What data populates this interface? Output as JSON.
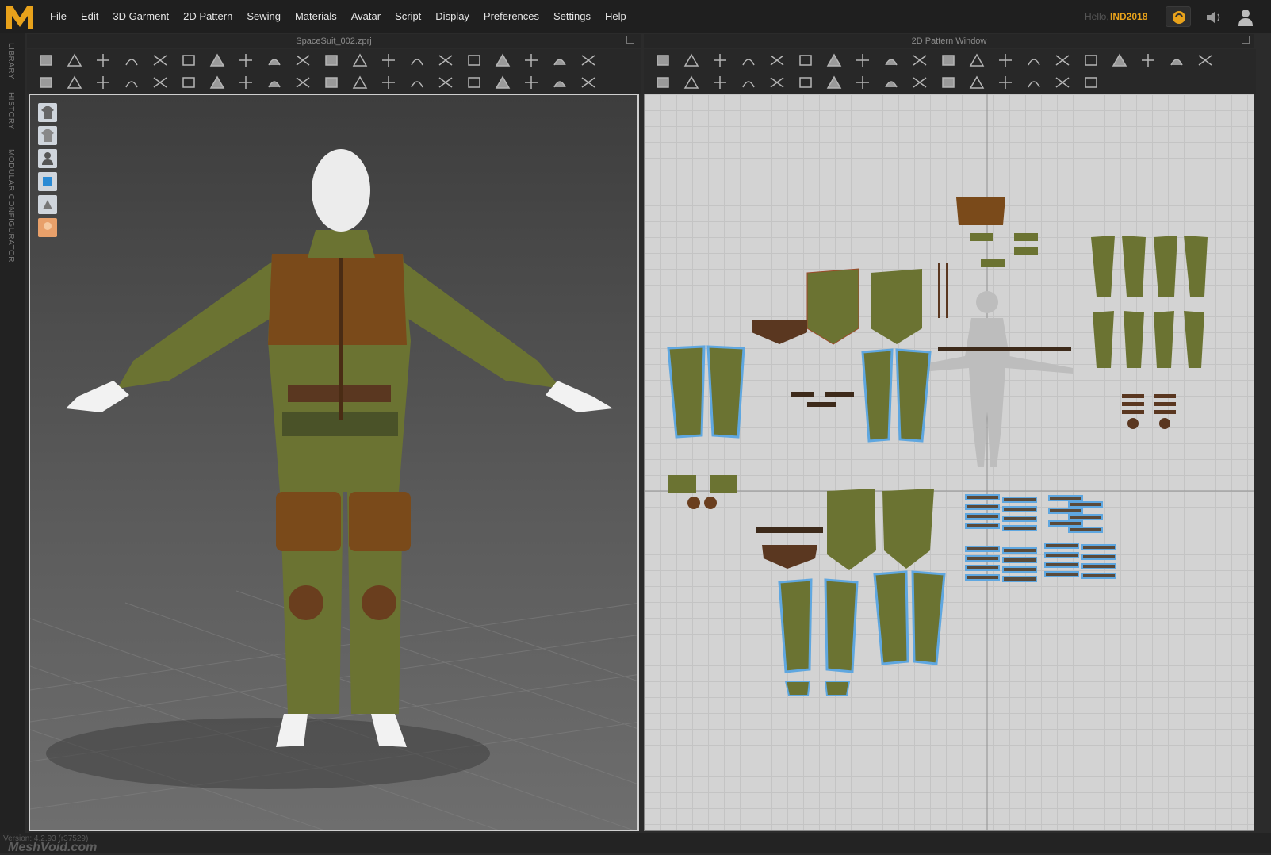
{
  "menubar": {
    "items": [
      "File",
      "Edit",
      "3D Garment",
      "2D Pattern",
      "Sewing",
      "Materials",
      "Avatar",
      "Script",
      "Display",
      "Preferences",
      "Settings",
      "Help"
    ],
    "greeting": "Hello,",
    "username": "IND2018"
  },
  "side_tabs": [
    "LIBRARY",
    "HISTORY",
    "MODULAR CONFIGURATOR"
  ],
  "panel_3d": {
    "title": "SpaceSuit_002.zprj"
  },
  "panel_2d": {
    "title": "2D Pattern Window"
  },
  "footer": {
    "version": "Version: 4.2.93 (r37529)",
    "watermark": "MeshVoid.com"
  },
  "colors": {
    "accent": "#e8a21b",
    "garment_olive": "#6b7332",
    "garment_brown": "#7a4a1a",
    "leather": "#5a3720",
    "pattern_outline": "#5fa7e0"
  },
  "icons": {
    "toolbar_3d_row1": [
      "select-move",
      "transform-pattern",
      "edit-pattern",
      "fold-arrangement",
      "segment-sewing",
      "free-sewing",
      "topstitch",
      "puckering",
      "pin",
      "tack"
    ],
    "toolbar_2d_row1": [
      "transform-pattern",
      "edit-pattern",
      "edit-curve",
      "rectangle",
      "ellipse",
      "polygon",
      "internal-rectangle",
      "internal-circle",
      "dart",
      "symmetry"
    ]
  }
}
